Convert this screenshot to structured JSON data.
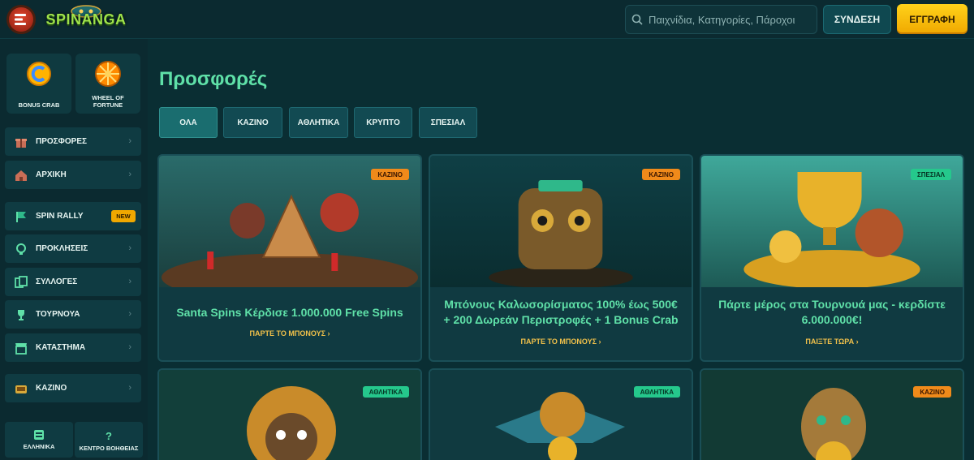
{
  "header": {
    "logo_text": "SPINANGA",
    "search_placeholder": "Παιχνίδια, Κατηγορίες, Πάροχοι",
    "login_label": "ΣΥΝΔΕΣΗ",
    "register_label": "ΕΓΓΡΑΦΗ"
  },
  "sidebar": {
    "quick": [
      {
        "label": "BONUS CRAB",
        "icon": "crab-coin-icon"
      },
      {
        "label": "WHEEL OF FORTUNE",
        "icon": "wheel-icon"
      }
    ],
    "items": [
      {
        "label": "ΠΡΟΣΦΟΡΕΣ",
        "icon": "gift-icon",
        "active": true
      },
      {
        "label": "ΑΡΧΙΚΗ",
        "icon": "home-icon"
      },
      {
        "label": "SPIN RALLY",
        "icon": "flag-icon",
        "badge": "NEW"
      },
      {
        "label": "ΠΡΟΚΛΗΣΕΙΣ",
        "icon": "challenge-icon"
      },
      {
        "label": "ΣΥΛΛΟΓΕΣ",
        "icon": "collections-icon"
      },
      {
        "label": "ΤΟΥΡΝΟΥΑ",
        "icon": "trophy-icon"
      },
      {
        "label": "ΚΑΤΑΣΤΗΜΑ",
        "icon": "store-icon"
      },
      {
        "label": "ΚΑΖΙΝΟ",
        "icon": "slot-icon"
      }
    ],
    "bottom": [
      {
        "label": "ΕΛΛΗΝΙΚΑ",
        "icon": "language-icon"
      },
      {
        "label": "ΚΕΝΤΡΟ ΒΟΗΘΕΙΑΣ",
        "icon": "help-icon"
      }
    ]
  },
  "main": {
    "title": "Προσφορές",
    "filters": [
      "ΟΛΑ",
      "ΚΑΖΙΝΟ",
      "ΑΘΛΗΤΙΚΑ",
      "ΚΡΥΠΤΟ",
      "ΣΠΕΣΙΑΛ"
    ],
    "cards": [
      {
        "tag": "ΚΑΖΙΝΟ",
        "title": "Santa Spins Κέρδισε 1.000.000 Free Spins",
        "cta": "ΠΑΡΤΕ ΤΟ ΜΠΟΝΟΥΣ ›"
      },
      {
        "tag": "ΚΑΖΙΝΟ",
        "title": "Μπόνους Καλωσορίσματος 100% έως 500€ + 200 Δωρεάν Περιστροφές + 1 Bonus Crab",
        "cta": "ΠΑΡΤΕ ΤΟ ΜΠΟΝΟΥΣ ›"
      },
      {
        "tag": "ΣΠΕΣΙΑΛ",
        "title": "Πάρτε μέρος στα Τουρνουά μας - κερδίστε 6.000.000€!",
        "cta": "ΠΑΙΞΤΕ ΤΩΡΑ ›"
      },
      {
        "tag": "ΑΘΛΗΤΙΚΑ"
      },
      {
        "tag": "ΑΘΛΗΤΙΚΑ"
      },
      {
        "tag": "ΚΑΖΙΝΟ"
      }
    ]
  }
}
